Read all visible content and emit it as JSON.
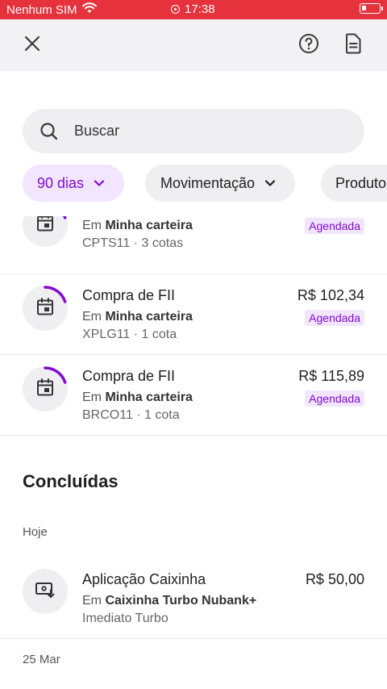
{
  "status_bar": {
    "carrier": "Nenhum SIM",
    "time": "17:38",
    "wifi_icon": "wifi-icon",
    "battery_icon": "battery-icon"
  },
  "top_bar": {
    "close_icon": "close-icon",
    "help_icon": "help-circle-icon",
    "document_icon": "document-icon"
  },
  "search": {
    "placeholder": "Buscar",
    "value": ""
  },
  "filters": [
    {
      "label": "90 dias",
      "active": true
    },
    {
      "label": "Movimentação",
      "active": false
    },
    {
      "label": "Produto",
      "active": false
    }
  ],
  "scheduled": [
    {
      "title": "",
      "prefix": "Em ",
      "account": "Minha carteira",
      "detail": "CPTS11 · 3 cotas",
      "amount": "",
      "badge": "Agendada"
    },
    {
      "title": "Compra de FII",
      "prefix": "Em ",
      "account": "Minha carteira",
      "detail": "XPLG11 · 1 cota",
      "amount": "R$ 102,34",
      "badge": "Agendada"
    },
    {
      "title": "Compra de FII",
      "prefix": "Em ",
      "account": "Minha carteira",
      "detail": "BRCO11 · 1 cota",
      "amount": "R$ 115,89",
      "badge": "Agendada"
    }
  ],
  "completed": {
    "section_title": "Concluídas",
    "groups": [
      {
        "date": "Hoje",
        "items": [
          {
            "title": "Aplicação Caixinha",
            "prefix": "Em ",
            "account": "Caixinha Turbo Nubank+",
            "detail": "Imediato Turbo",
            "amount": "R$ 50,00"
          }
        ]
      },
      {
        "date": "25 Mar",
        "items": []
      }
    ]
  },
  "colors": {
    "status_bar": "#e5323c",
    "accent": "#820ad1",
    "accent_bg": "#f1e6fd",
    "surface": "#efeff1"
  }
}
